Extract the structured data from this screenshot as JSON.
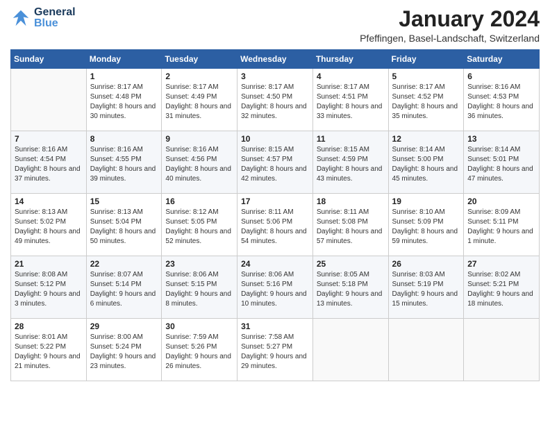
{
  "header": {
    "logo_general": "General",
    "logo_blue": "Blue",
    "month_title": "January 2024",
    "subtitle": "Pfeffingen, Basel-Landschaft, Switzerland"
  },
  "weekdays": [
    "Sunday",
    "Monday",
    "Tuesday",
    "Wednesday",
    "Thursday",
    "Friday",
    "Saturday"
  ],
  "weeks": [
    {
      "days": [
        {
          "num": "",
          "sunrise": "",
          "sunset": "",
          "daylight": ""
        },
        {
          "num": "1",
          "sunrise": "Sunrise: 8:17 AM",
          "sunset": "Sunset: 4:48 PM",
          "daylight": "Daylight: 8 hours and 30 minutes."
        },
        {
          "num": "2",
          "sunrise": "Sunrise: 8:17 AM",
          "sunset": "Sunset: 4:49 PM",
          "daylight": "Daylight: 8 hours and 31 minutes."
        },
        {
          "num": "3",
          "sunrise": "Sunrise: 8:17 AM",
          "sunset": "Sunset: 4:50 PM",
          "daylight": "Daylight: 8 hours and 32 minutes."
        },
        {
          "num": "4",
          "sunrise": "Sunrise: 8:17 AM",
          "sunset": "Sunset: 4:51 PM",
          "daylight": "Daylight: 8 hours and 33 minutes."
        },
        {
          "num": "5",
          "sunrise": "Sunrise: 8:17 AM",
          "sunset": "Sunset: 4:52 PM",
          "daylight": "Daylight: 8 hours and 35 minutes."
        },
        {
          "num": "6",
          "sunrise": "Sunrise: 8:16 AM",
          "sunset": "Sunset: 4:53 PM",
          "daylight": "Daylight: 8 hours and 36 minutes."
        }
      ]
    },
    {
      "days": [
        {
          "num": "7",
          "sunrise": "Sunrise: 8:16 AM",
          "sunset": "Sunset: 4:54 PM",
          "daylight": "Daylight: 8 hours and 37 minutes."
        },
        {
          "num": "8",
          "sunrise": "Sunrise: 8:16 AM",
          "sunset": "Sunset: 4:55 PM",
          "daylight": "Daylight: 8 hours and 39 minutes."
        },
        {
          "num": "9",
          "sunrise": "Sunrise: 8:16 AM",
          "sunset": "Sunset: 4:56 PM",
          "daylight": "Daylight: 8 hours and 40 minutes."
        },
        {
          "num": "10",
          "sunrise": "Sunrise: 8:15 AM",
          "sunset": "Sunset: 4:57 PM",
          "daylight": "Daylight: 8 hours and 42 minutes."
        },
        {
          "num": "11",
          "sunrise": "Sunrise: 8:15 AM",
          "sunset": "Sunset: 4:59 PM",
          "daylight": "Daylight: 8 hours and 43 minutes."
        },
        {
          "num": "12",
          "sunrise": "Sunrise: 8:14 AM",
          "sunset": "Sunset: 5:00 PM",
          "daylight": "Daylight: 8 hours and 45 minutes."
        },
        {
          "num": "13",
          "sunrise": "Sunrise: 8:14 AM",
          "sunset": "Sunset: 5:01 PM",
          "daylight": "Daylight: 8 hours and 47 minutes."
        }
      ]
    },
    {
      "days": [
        {
          "num": "14",
          "sunrise": "Sunrise: 8:13 AM",
          "sunset": "Sunset: 5:02 PM",
          "daylight": "Daylight: 8 hours and 49 minutes."
        },
        {
          "num": "15",
          "sunrise": "Sunrise: 8:13 AM",
          "sunset": "Sunset: 5:04 PM",
          "daylight": "Daylight: 8 hours and 50 minutes."
        },
        {
          "num": "16",
          "sunrise": "Sunrise: 8:12 AM",
          "sunset": "Sunset: 5:05 PM",
          "daylight": "Daylight: 8 hours and 52 minutes."
        },
        {
          "num": "17",
          "sunrise": "Sunrise: 8:11 AM",
          "sunset": "Sunset: 5:06 PM",
          "daylight": "Daylight: 8 hours and 54 minutes."
        },
        {
          "num": "18",
          "sunrise": "Sunrise: 8:11 AM",
          "sunset": "Sunset: 5:08 PM",
          "daylight": "Daylight: 8 hours and 57 minutes."
        },
        {
          "num": "19",
          "sunrise": "Sunrise: 8:10 AM",
          "sunset": "Sunset: 5:09 PM",
          "daylight": "Daylight: 8 hours and 59 minutes."
        },
        {
          "num": "20",
          "sunrise": "Sunrise: 8:09 AM",
          "sunset": "Sunset: 5:11 PM",
          "daylight": "Daylight: 9 hours and 1 minute."
        }
      ]
    },
    {
      "days": [
        {
          "num": "21",
          "sunrise": "Sunrise: 8:08 AM",
          "sunset": "Sunset: 5:12 PM",
          "daylight": "Daylight: 9 hours and 3 minutes."
        },
        {
          "num": "22",
          "sunrise": "Sunrise: 8:07 AM",
          "sunset": "Sunset: 5:14 PM",
          "daylight": "Daylight: 9 hours and 6 minutes."
        },
        {
          "num": "23",
          "sunrise": "Sunrise: 8:06 AM",
          "sunset": "Sunset: 5:15 PM",
          "daylight": "Daylight: 9 hours and 8 minutes."
        },
        {
          "num": "24",
          "sunrise": "Sunrise: 8:06 AM",
          "sunset": "Sunset: 5:16 PM",
          "daylight": "Daylight: 9 hours and 10 minutes."
        },
        {
          "num": "25",
          "sunrise": "Sunrise: 8:05 AM",
          "sunset": "Sunset: 5:18 PM",
          "daylight": "Daylight: 9 hours and 13 minutes."
        },
        {
          "num": "26",
          "sunrise": "Sunrise: 8:03 AM",
          "sunset": "Sunset: 5:19 PM",
          "daylight": "Daylight: 9 hours and 15 minutes."
        },
        {
          "num": "27",
          "sunrise": "Sunrise: 8:02 AM",
          "sunset": "Sunset: 5:21 PM",
          "daylight": "Daylight: 9 hours and 18 minutes."
        }
      ]
    },
    {
      "days": [
        {
          "num": "28",
          "sunrise": "Sunrise: 8:01 AM",
          "sunset": "Sunset: 5:22 PM",
          "daylight": "Daylight: 9 hours and 21 minutes."
        },
        {
          "num": "29",
          "sunrise": "Sunrise: 8:00 AM",
          "sunset": "Sunset: 5:24 PM",
          "daylight": "Daylight: 9 hours and 23 minutes."
        },
        {
          "num": "30",
          "sunrise": "Sunrise: 7:59 AM",
          "sunset": "Sunset: 5:26 PM",
          "daylight": "Daylight: 9 hours and 26 minutes."
        },
        {
          "num": "31",
          "sunrise": "Sunrise: 7:58 AM",
          "sunset": "Sunset: 5:27 PM",
          "daylight": "Daylight: 9 hours and 29 minutes."
        },
        {
          "num": "",
          "sunrise": "",
          "sunset": "",
          "daylight": ""
        },
        {
          "num": "",
          "sunrise": "",
          "sunset": "",
          "daylight": ""
        },
        {
          "num": "",
          "sunrise": "",
          "sunset": "",
          "daylight": ""
        }
      ]
    }
  ]
}
